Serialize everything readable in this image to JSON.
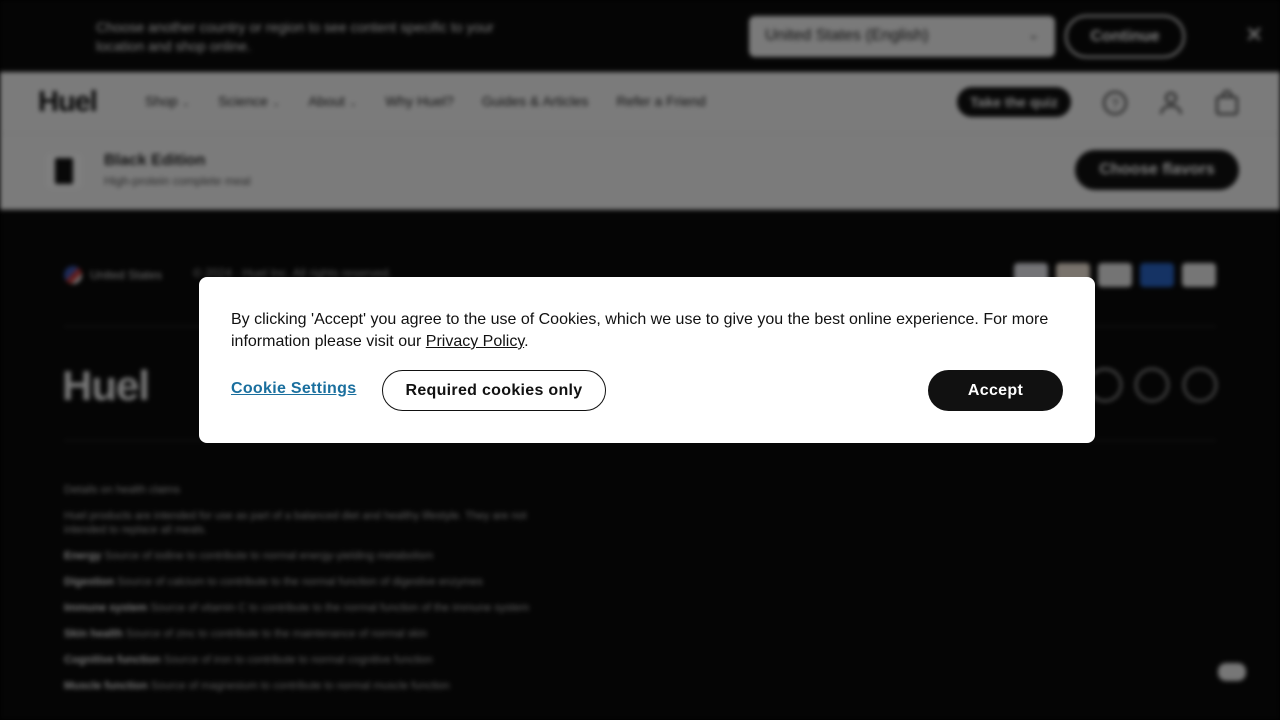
{
  "country_banner": {
    "message": "Choose another country or region to see content specific to your location and shop online.",
    "selected_country": "United States (English)",
    "continue_label": "Continue",
    "close_glyph": "✕"
  },
  "nav": {
    "logo": "Huel",
    "links": [
      {
        "label": "Shop",
        "has_dropdown": true
      },
      {
        "label": "Science",
        "has_dropdown": true
      },
      {
        "label": "About",
        "has_dropdown": true
      },
      {
        "label": "Why Huel?",
        "has_dropdown": false
      },
      {
        "label": "Guides & Articles",
        "has_dropdown": false
      },
      {
        "label": "Refer a Friend",
        "has_dropdown": false
      }
    ],
    "quiz_label": "Take the quiz",
    "icons": [
      "help-icon",
      "account-icon",
      "cart-icon"
    ]
  },
  "product_bar": {
    "name": "Black Edition",
    "subtitle": "High-protein complete meal",
    "cta": "Choose flavors"
  },
  "footer": {
    "region": "United States",
    "copyright": "© 2024 · Huel Inc. All rights reserved.",
    "payment_icons": [
      "visa-icon",
      "mastercard-icon",
      "paypal-icon",
      "amex-icon",
      "applepay-icon"
    ],
    "logo": "Huel",
    "social_icons": [
      "instagram-icon",
      "tiktok-icon",
      "youtube-icon"
    ],
    "legal_lines": [
      {
        "bold": "",
        "text": "Details on health claims"
      },
      {
        "bold": "",
        "text": "Huel products are intended for use as part of a balanced diet and healthy lifestyle. They are not intended to replace all meals."
      },
      {
        "bold": "Energy",
        "text": " Source of iodine to contribute to normal energy-yielding metabolism"
      },
      {
        "bold": "Digestion",
        "text": " Source of calcium to contribute to the normal function of digestive enzymes"
      },
      {
        "bold": "Immune system",
        "text": " Source of vitamin C to contribute to the normal function of the immune system"
      },
      {
        "bold": "Skin health",
        "text": " Source of zinc to contribute to the maintenance of normal skin"
      },
      {
        "bold": "Cognitive function",
        "text": " Source of iron to contribute to normal cognitive function"
      },
      {
        "bold": "Muscle function",
        "text": " Source of magnesium to contribute to normal muscle function"
      }
    ]
  },
  "cookie_modal": {
    "text_before_link": "By clicking 'Accept' you agree to the use of Cookies, which we use to give you the best online experience. For more information please visit our ",
    "privacy_link": "Privacy Policy",
    "text_after_link": ".",
    "settings_label": "Cookie Settings",
    "required_label": "Required cookies only",
    "accept_label": "Accept"
  },
  "colors": {
    "settings_link": "#1a6f9e",
    "accept_bg": "#111111",
    "modal_bg": "#ffffff",
    "overlay": "rgba(0,0,0,0.5)"
  }
}
